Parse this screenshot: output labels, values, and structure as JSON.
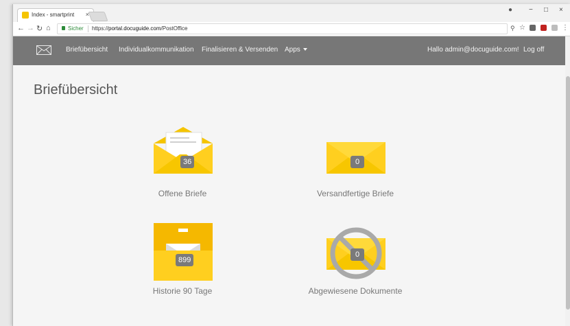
{
  "browser": {
    "tab_title": "Index - smartprint",
    "tab_close": "×",
    "secure_label": "Sicher",
    "url_scheme": "https://",
    "url_host": "portal.docuguide.com",
    "url_path": "/PostOffice",
    "win_controls": [
      "−",
      "□",
      "×"
    ],
    "account_glyph": "●"
  },
  "nav": {
    "links": [
      "Briefübersicht",
      "Individualkommunikation",
      "Finalisieren & Versenden",
      "Apps"
    ],
    "greeting": "Hallo admin@docuguide.com!",
    "logoff": "Log off"
  },
  "page": {
    "title": "Briefübersicht"
  },
  "tiles": [
    {
      "label": "Offene Briefe",
      "count": "36",
      "icon": "open-envelope-icon"
    },
    {
      "label": "Versandfertige Briefe",
      "count": "0",
      "icon": "closed-envelope-icon"
    },
    {
      "label": "Historie 90 Tage",
      "count": "899",
      "icon": "archive-box-icon"
    },
    {
      "label": "Abgewiesene Dokumente",
      "count": "0",
      "icon": "rejected-envelope-icon"
    }
  ],
  "colors": {
    "accent": "#f5c400",
    "accent_light": "#ffd93a",
    "nav_bg": "#777777",
    "badge": "#7a7a7a"
  }
}
